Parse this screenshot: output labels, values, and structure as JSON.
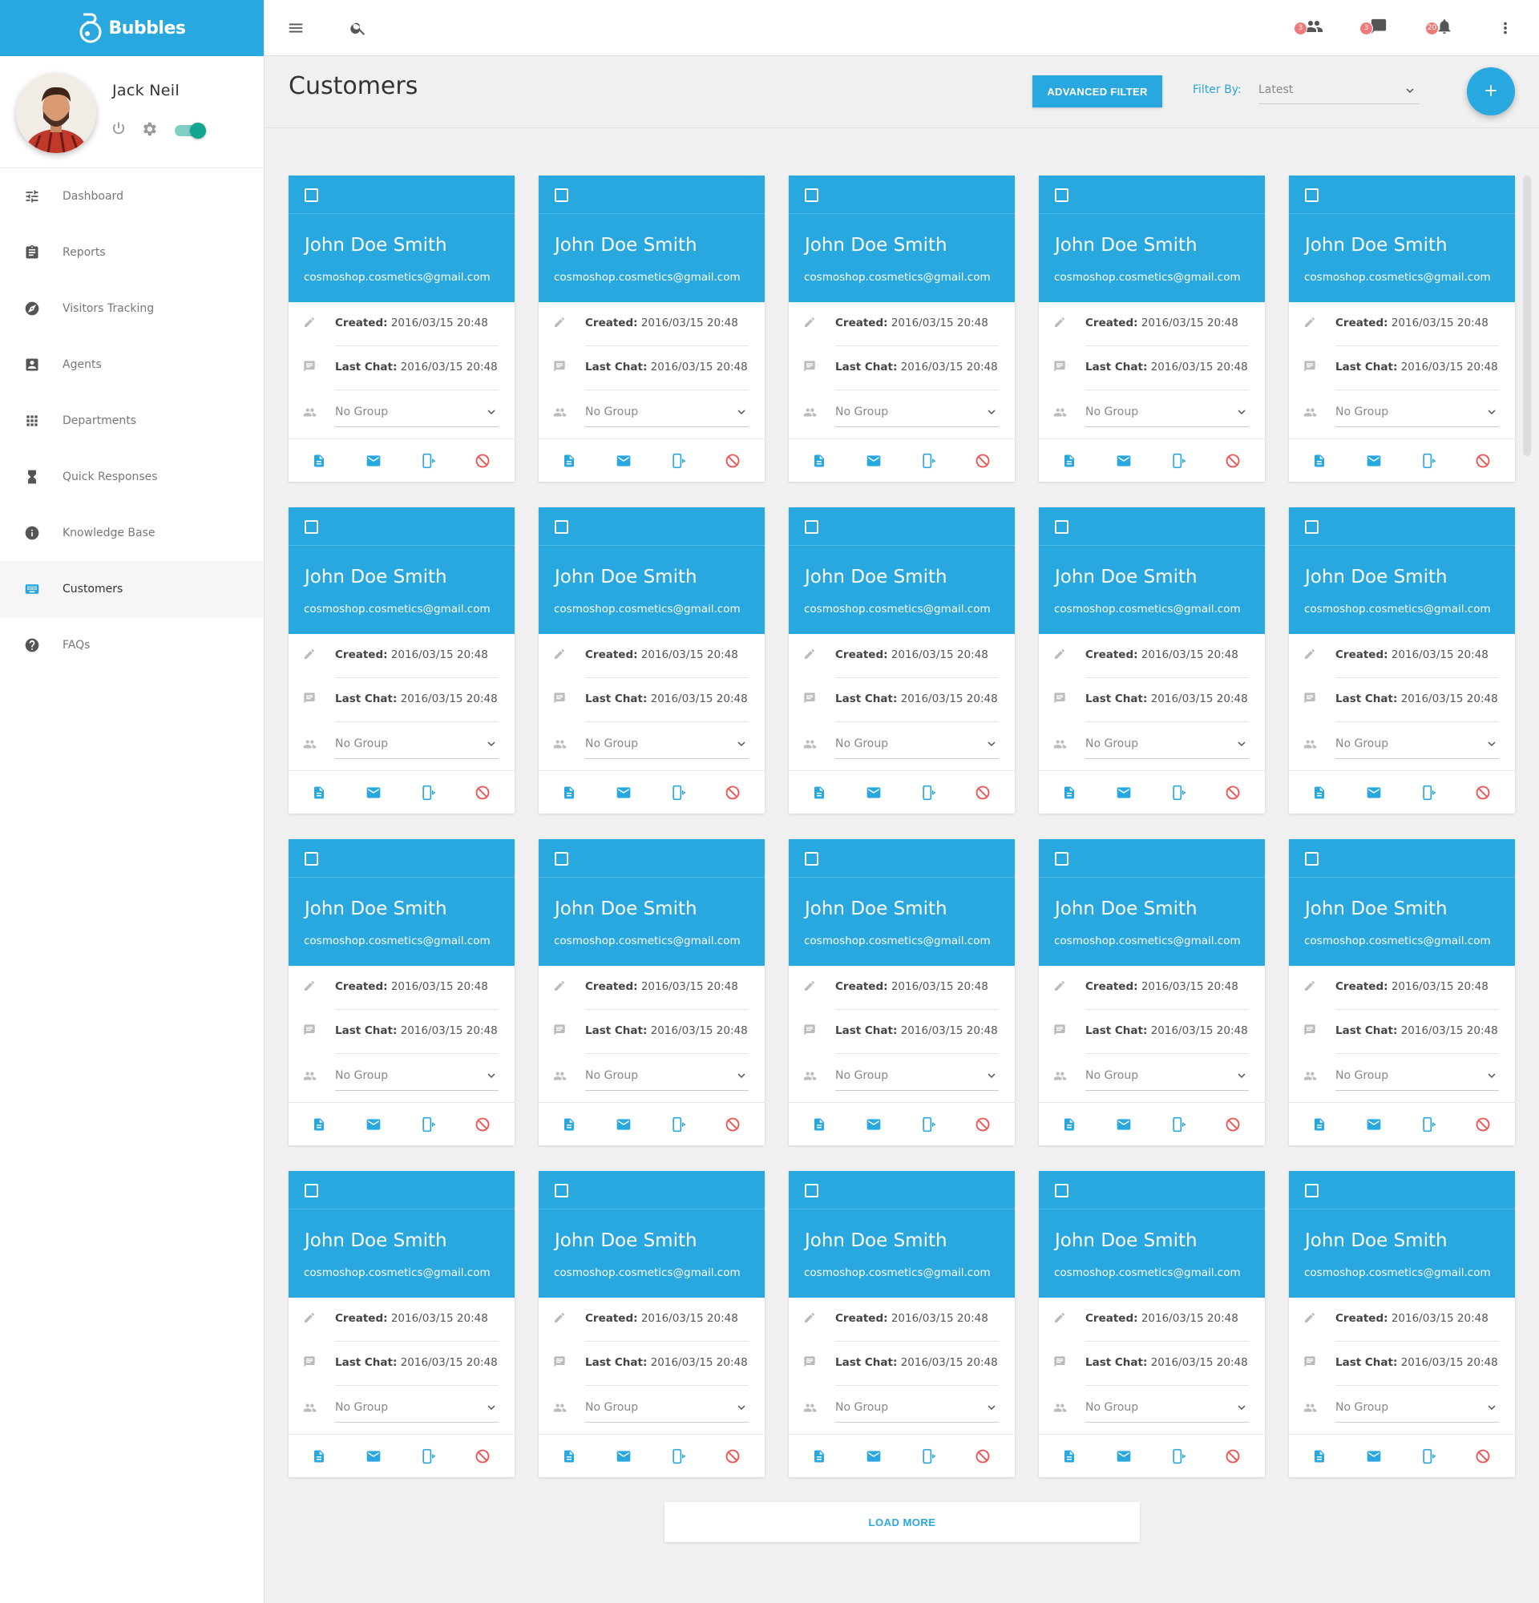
{
  "brand": {
    "name": "Bubbles"
  },
  "profile": {
    "name": "Jack Neil",
    "status_on": true
  },
  "sidebar": {
    "items": [
      {
        "label": "Dashboard",
        "icon": "sliders-icon"
      },
      {
        "label": "Reports",
        "icon": "clipboard-icon"
      },
      {
        "label": "Visitors Tracking",
        "icon": "compass-icon"
      },
      {
        "label": "Agents",
        "icon": "contact-card-icon"
      },
      {
        "label": "Departments",
        "icon": "grid-icon"
      },
      {
        "label": "Quick Responses",
        "icon": "hourglass-icon"
      },
      {
        "label": "Knowledge Base",
        "icon": "info-icon"
      },
      {
        "label": "Customers",
        "icon": "keyboard-icon",
        "active": true
      },
      {
        "label": "FAQs",
        "icon": "help-icon"
      }
    ]
  },
  "topbar": {
    "people_count": "3",
    "chat_count": "3",
    "notification_count": "20"
  },
  "header": {
    "title": "Customers",
    "advanced_filter_label": "ADVANCED FILTER",
    "filter_by_label": "Filter By:",
    "filter_value": "Latest"
  },
  "labels": {
    "created": "Created:",
    "last_chat": "Last Chat:"
  },
  "customers": [
    {
      "name": "John Doe Smith",
      "email": "cosmoshop.cosmetics@gmail.com",
      "created": "2016/03/15 20:48",
      "last_chat": "2016/03/15 20:48",
      "group": "No Group"
    },
    {
      "name": "John Doe Smith",
      "email": "cosmoshop.cosmetics@gmail.com",
      "created": "2016/03/15 20:48",
      "last_chat": "2016/03/15 20:48",
      "group": "No Group"
    },
    {
      "name": "John Doe Smith",
      "email": "cosmoshop.cosmetics@gmail.com",
      "created": "2016/03/15 20:48",
      "last_chat": "2016/03/15 20:48",
      "group": "No Group"
    },
    {
      "name": "John Doe Smith",
      "email": "cosmoshop.cosmetics@gmail.com",
      "created": "2016/03/15 20:48",
      "last_chat": "2016/03/15 20:48",
      "group": "No Group"
    },
    {
      "name": "John Doe Smith",
      "email": "cosmoshop.cosmetics@gmail.com",
      "created": "2016/03/15 20:48",
      "last_chat": "2016/03/15 20:48",
      "group": "No Group"
    },
    {
      "name": "John Doe Smith",
      "email": "cosmoshop.cosmetics@gmail.com",
      "created": "2016/03/15 20:48",
      "last_chat": "2016/03/15 20:48",
      "group": "No Group"
    },
    {
      "name": "John Doe Smith",
      "email": "cosmoshop.cosmetics@gmail.com",
      "created": "2016/03/15 20:48",
      "last_chat": "2016/03/15 20:48",
      "group": "No Group"
    },
    {
      "name": "John Doe Smith",
      "email": "cosmoshop.cosmetics@gmail.com",
      "created": "2016/03/15 20:48",
      "last_chat": "2016/03/15 20:48",
      "group": "No Group"
    },
    {
      "name": "John Doe Smith",
      "email": "cosmoshop.cosmetics@gmail.com",
      "created": "2016/03/15 20:48",
      "last_chat": "2016/03/15 20:48",
      "group": "No Group"
    },
    {
      "name": "John Doe Smith",
      "email": "cosmoshop.cosmetics@gmail.com",
      "created": "2016/03/15 20:48",
      "last_chat": "2016/03/15 20:48",
      "group": "No Group"
    },
    {
      "name": "John Doe Smith",
      "email": "cosmoshop.cosmetics@gmail.com",
      "created": "2016/03/15 20:48",
      "last_chat": "2016/03/15 20:48",
      "group": "No Group"
    },
    {
      "name": "John Doe Smith",
      "email": "cosmoshop.cosmetics@gmail.com",
      "created": "2016/03/15 20:48",
      "last_chat": "2016/03/15 20:48",
      "group": "No Group"
    },
    {
      "name": "John Doe Smith",
      "email": "cosmoshop.cosmetics@gmail.com",
      "created": "2016/03/15 20:48",
      "last_chat": "2016/03/15 20:48",
      "group": "No Group"
    },
    {
      "name": "John Doe Smith",
      "email": "cosmoshop.cosmetics@gmail.com",
      "created": "2016/03/15 20:48",
      "last_chat": "2016/03/15 20:48",
      "group": "No Group"
    },
    {
      "name": "John Doe Smith",
      "email": "cosmoshop.cosmetics@gmail.com",
      "created": "2016/03/15 20:48",
      "last_chat": "2016/03/15 20:48",
      "group": "No Group"
    },
    {
      "name": "John Doe Smith",
      "email": "cosmoshop.cosmetics@gmail.com",
      "created": "2016/03/15 20:48",
      "last_chat": "2016/03/15 20:48",
      "group": "No Group"
    },
    {
      "name": "John Doe Smith",
      "email": "cosmoshop.cosmetics@gmail.com",
      "created": "2016/03/15 20:48",
      "last_chat": "2016/03/15 20:48",
      "group": "No Group"
    },
    {
      "name": "John Doe Smith",
      "email": "cosmoshop.cosmetics@gmail.com",
      "created": "2016/03/15 20:48",
      "last_chat": "2016/03/15 20:48",
      "group": "No Group"
    },
    {
      "name": "John Doe Smith",
      "email": "cosmoshop.cosmetics@gmail.com",
      "created": "2016/03/15 20:48",
      "last_chat": "2016/03/15 20:48",
      "group": "No Group"
    },
    {
      "name": "John Doe Smith",
      "email": "cosmoshop.cosmetics@gmail.com",
      "created": "2016/03/15 20:48",
      "last_chat": "2016/03/15 20:48",
      "group": "No Group"
    }
  ],
  "card_actions": [
    "document-icon",
    "mail-icon",
    "phone-vibrate-icon",
    "block-icon"
  ],
  "load_more_label": "LOAD MORE",
  "colors": {
    "accent": "#29a8e0",
    "badge": "#f07a7a",
    "toggle": "#13a58f",
    "block": "#f05050"
  }
}
